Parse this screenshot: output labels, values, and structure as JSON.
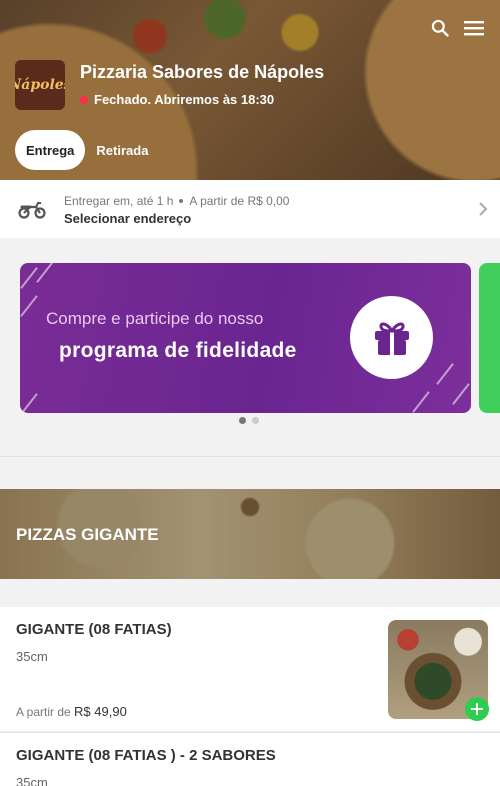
{
  "store": {
    "name": "Pizzaria Sabores de Nápoles",
    "logo_text": "Nápoles",
    "status": "Fechado. Abriremos às 18:30",
    "status_color": "#ff2b4a"
  },
  "header_icons": [
    "search-icon",
    "menu-icon"
  ],
  "tabs": [
    {
      "label": "Entrega",
      "active": true
    },
    {
      "label": "Retirada",
      "active": false
    }
  ],
  "delivery": {
    "time_text": "Entregar em, até 1 h",
    "min_text": "A partir de R$ 0,00",
    "address_label": "Selecionar endereço"
  },
  "banner": {
    "line1": "Compre e participe do nosso",
    "line2": "programa de fidelidade",
    "icon": "gift-icon",
    "color": "#7a2c96"
  },
  "carousel": {
    "pages": 2,
    "active_index": 0
  },
  "category": {
    "title": "PIZZAS GIGANTE"
  },
  "products": [
    {
      "name": "GIGANTE (08 FATIAS)",
      "size": "35cm",
      "price_prefix": "A partir de",
      "price": "R$ 49,90"
    },
    {
      "name": "GIGANTE (08 FATIAS ) - 2 SABORES",
      "size": "35cm"
    }
  ],
  "accent_color": "#2ecc4f"
}
